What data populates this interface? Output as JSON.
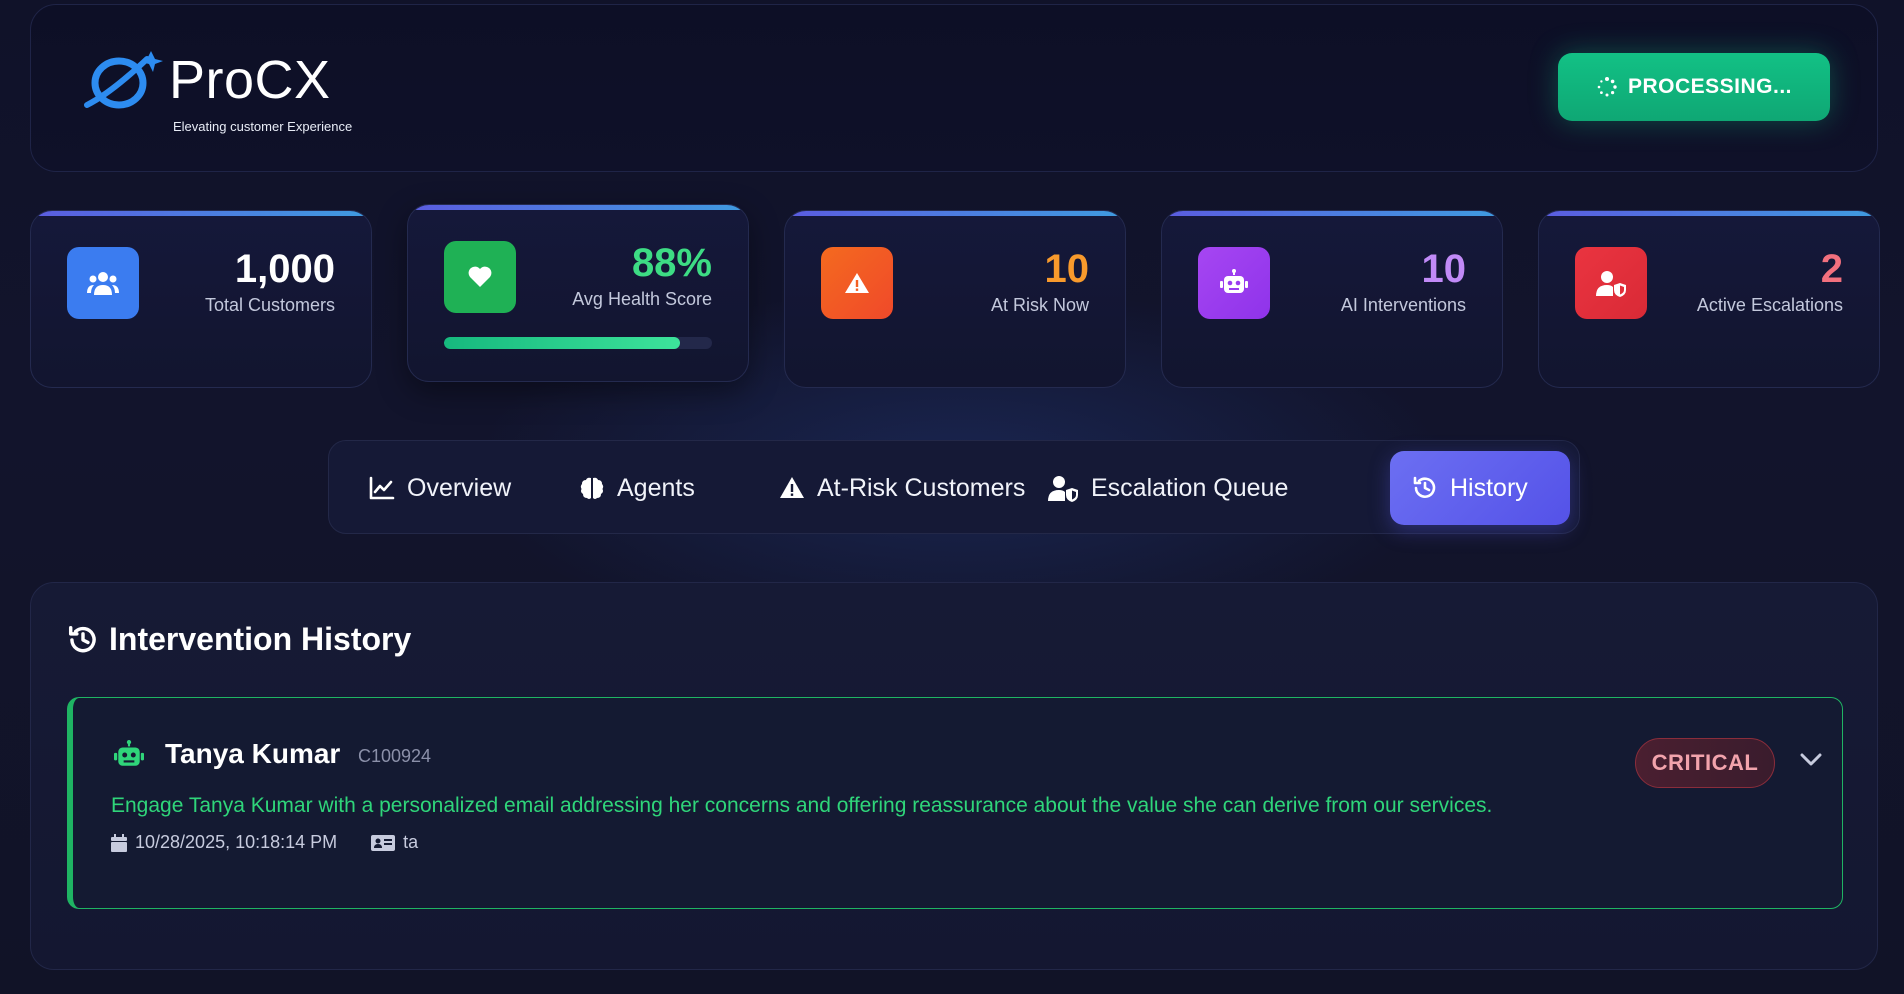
{
  "header": {
    "brand": "ProCX",
    "tagline": "Elevating customer Experience",
    "process_button": "PROCESSING..."
  },
  "stats": [
    {
      "value": "1,000",
      "label": "Total Customers",
      "icon": "users-icon",
      "color": "#3b7cf0",
      "value_color": "#ffffff"
    },
    {
      "value": "88%",
      "label": "Avg Health Score",
      "icon": "heart-icon",
      "color": "#1fb155",
      "value_color": "#3ddc84",
      "progress": 0.88
    },
    {
      "value": "10",
      "label": "At Risk Now",
      "icon": "warning-icon",
      "color": "#f35f22",
      "value_color": "#f89a2c"
    },
    {
      "value": "10",
      "label": "AI Interventions",
      "icon": "robot-icon",
      "color": "#9a3cf0",
      "value_color": "#c18af7"
    },
    {
      "value": "2",
      "label": "Active Escalations",
      "icon": "user-shield-icon",
      "color": "#e2303b",
      "value_color": "#f2707e"
    }
  ],
  "tabs": [
    {
      "label": "Overview",
      "icon": "chart-line-icon",
      "active": false
    },
    {
      "label": "Agents",
      "icon": "brain-icon",
      "active": false
    },
    {
      "label": "At-Risk Customers",
      "icon": "warning-icon",
      "active": false
    },
    {
      "label": "Escalation Queue",
      "icon": "user-shield-icon",
      "active": false
    },
    {
      "label": "History",
      "icon": "history-icon",
      "active": true
    }
  ],
  "history": {
    "title": "Intervention History",
    "items": [
      {
        "name": "Tanya Kumar",
        "customer_id": "C100924",
        "message": "Engage Tanya Kumar with a personalized email addressing her concerns and offering reassurance about the value she can derive from our services.",
        "timestamp": "10/28/2025, 10:18:14 PM",
        "agent": "ta",
        "severity": "CRITICAL",
        "accent_color": "#1fb463"
      }
    ]
  }
}
